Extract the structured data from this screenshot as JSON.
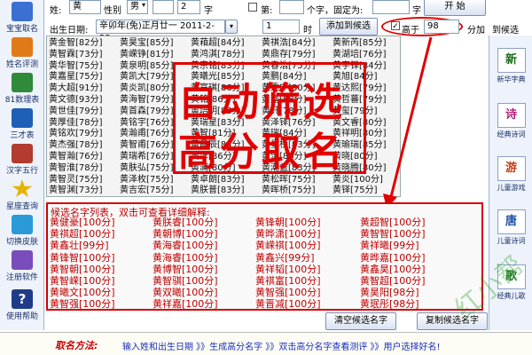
{
  "sidebar": {
    "items": [
      {
        "label": "宝宝取名",
        "icon": "baby-icon",
        "color": "#3b6fd1"
      },
      {
        "label": "姓名评测",
        "icon": "person-icon",
        "color": "#e07a19"
      },
      {
        "label": "81数理表",
        "icon": "table-icon",
        "color": "#2f8a3a"
      },
      {
        "label": "三才表",
        "icon": "grid-icon",
        "color": "#1d5fb7"
      },
      {
        "label": "汉字五行",
        "icon": "book-icon",
        "color": "#b33b2f"
      },
      {
        "label": "星座查询",
        "icon": "star-icon",
        "color": "#e6b400"
      },
      {
        "label": "切换皮肤",
        "icon": "shirt-icon",
        "color": "#2a9bd6"
      },
      {
        "label": "注册软件",
        "icon": "key-icon",
        "color": "#7a4dbd"
      },
      {
        "label": "使用帮助",
        "icon": "help-icon",
        "color": "#1f3c88"
      }
    ]
  },
  "right_sidebar": {
    "items": [
      {
        "glyph": "新",
        "label": "新华字典",
        "color": "#1a6b1a"
      },
      {
        "glyph": "诗",
        "label": "经典诗词",
        "color": "#b01f7a"
      },
      {
        "glyph": "游",
        "label": "儿童游戏",
        "color": "#c23b12"
      },
      {
        "glyph": "唐",
        "label": "儿童诗词",
        "color": "#1f4fa8"
      },
      {
        "glyph": "歌",
        "label": "经典儿歌",
        "color": "#2b7a2b"
      }
    ]
  },
  "top_row": {
    "surname_label": "姓:",
    "surname_value": "黄",
    "gender_label": "性别",
    "gender_value": "男",
    "count_value": "2",
    "count_unit": "字",
    "first_label": "第:",
    "first_hint": "个字，固定为:",
    "char_unit": "字",
    "start_label": "开  始"
  },
  "second_row": {
    "birth_label": "出生日期:",
    "birth_value": "辛卯年(兔)正月廿一  2011-2-23",
    "hour_value": "1",
    "hour_unit": "时",
    "add_label": "添加到候选",
    "above_checked": true,
    "above_label": "高于",
    "above_value": "98",
    "score_unit": "分加",
    "to_cand_label": "到候选"
  },
  "names_grid": {
    "columns": [
      [
        "黄金智[82分]",
        "黄智霖[73分]",
        "黄华智[75分]",
        "黄嘉星[75分]",
        "黄大超[91分]",
        "黄文德[93分]",
        "黄世佳[79分]",
        "黄厚佳[78分]",
        "黄铭欢[79分]",
        "黄杰强[78分]",
        "黄智瀚[76分]",
        "黄智淮[78分]",
        "黄智灵[75分]",
        "黄智渊[73分]"
      ],
      [
        "黄昊宝[85分]",
        "黄嵘铮[81分]",
        "黄泉明[85分]",
        "黄凯大[79分]",
        "黄炎凯[80分]",
        "黄海智[79分]",
        "黄首森[79分]",
        "黄铭宇[76分]",
        "黄瀚甫[76分]",
        "黄智甫[76分]",
        "黄瑞希[76分]",
        "黄肤弘[75分]",
        "黄泽枚[75分]",
        "黄吉宏[75分]"
      ],
      [
        "黄葙超[84分]",
        "黄鸿淇[78分]",
        "黄宗铭[83分]",
        "黄曦光[85分]",
        "黄富琪[86分]",
        "黄铭[86分]",
        "黄培明[83分]",
        "黄瑞星[83分]",
        "黄智[81分]",
        "黄晶辰[84分]",
        "黄淳[86分]",
        "黄澜[80分]",
        "黄卓朗[83分]",
        "黄朕普[83分]"
      ],
      [
        "黄祺浩[84分]",
        "黄鼎存[79分]",
        "黄春浩[75分]",
        "黄鹏[84分]",
        "黄秉宁[80分]",
        "黄嘉[88分]",
        "黄轩[78分]",
        "黄泽铎[76分]",
        "黄瑞[84分]",
        "黄星桥[83分]",
        "黄涛[80分]",
        "黄潮益[83分]",
        "黄松晖[75分]",
        "黄晖桥[75分]"
      ],
      [
        "黄新芮[85分]",
        "黄湖培[76分]",
        "黄宇铎[84分]",
        "黄旭[84分]",
        "黄达熙[79分]",
        "黄哲蕃[79分]",
        "黄玺[79分]",
        "黄文睿[80分]",
        "黄祥明[80分]",
        "黄瑜瑞[85分]",
        "黄晓[80分]",
        "黄晓腾[80分]",
        "黄炎[100分]",
        "黄铎[75分]"
      ]
    ]
  },
  "overlay": {
    "line1": "自动筛选",
    "line2": "高分取名"
  },
  "candidates": {
    "title": "候选名字列表，双击可查看详细解释:",
    "columns": [
      [
        "黄健豪[100分]",
        "黄祺超[100分]",
        "黄鑫壮[99分]",
        "黄锋智[100分]",
        "黄智朝[100分]",
        "黄智嵘[100分]",
        "黄曦文[100分]",
        "黄智强[100分]"
      ],
      [
        "黄朕睿[100分]",
        "黄朝博[100分]",
        "黄海睿[100分]",
        "黄海睿[100分]",
        "黄博智[100分]",
        "黄智骐[100分]",
        "黄双曦[100分]",
        "黄祥嘉[100分]"
      ],
      [
        "黄锋朝[100分]",
        "黄晔潇[100分]",
        "黄嵘祺[100分]",
        "黄鑫兴[99分]",
        "黄祥韬[100分]",
        "黄祺富[100分]",
        "黄智强[100分]",
        "黄晋减[100分]"
      ],
      [
        "黄超智[100分]",
        "黄智智[100分]",
        "黄祥曦[99分]",
        "黄晔嘉[100分]",
        "黄鑫昊[100分]",
        "黄智超[100分]",
        "黄昊阳[98分]",
        "黄珉彤[98分]"
      ]
    ],
    "clear_label": "清空候选名字",
    "copy_label": "复制候选名字"
  },
  "bottom": {
    "method_label": "取名方法:",
    "steps": "输入姓和出生日期 》》生成高分名字 》》双击高分名字查看测评 》》用户选择好名!"
  },
  "watermark": "红小帮"
}
